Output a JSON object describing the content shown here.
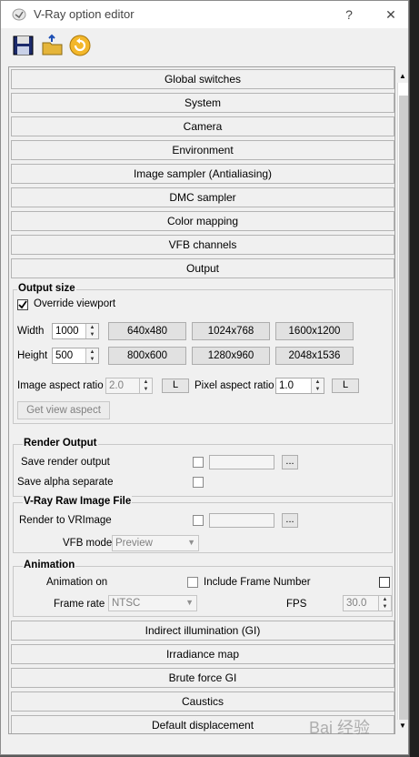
{
  "window": {
    "title": "V-Ray option editor",
    "help": "?",
    "close": "✕"
  },
  "toolbar": {
    "save_icon": "save-icon",
    "open_icon": "open-icon",
    "reset_icon": "reset-icon"
  },
  "rollouts_top": [
    "Global switches",
    "System",
    "Camera",
    "Environment",
    "Image sampler (Antialiasing)",
    "DMC sampler",
    "Color mapping",
    "VFB channels",
    "Output"
  ],
  "output_size": {
    "title": "Output size",
    "override_label": "Override viewport",
    "override_checked": true,
    "width_label": "Width",
    "width_value": "1000",
    "height_label": "Height",
    "height_value": "500",
    "presets_row1": [
      "640x480",
      "1024x768",
      "1600x1200"
    ],
    "presets_row2": [
      "800x600",
      "1280x960",
      "2048x1536"
    ],
    "image_aspect_label": "Image aspect ratio",
    "image_aspect_value": "2.0",
    "lock_label": "L",
    "pixel_aspect_label": "Pixel aspect ratio",
    "pixel_aspect_value": "1.0",
    "get_view_aspect": "Get view aspect"
  },
  "render_output": {
    "title": "Render Output",
    "save_render_label": "Save render output",
    "save_alpha_label": "Save alpha separate",
    "browse": "..."
  },
  "vray_raw": {
    "title": "V-Ray Raw Image File",
    "render_to_label": "Render to VRImage",
    "vfb_mode_label": "VFB mode",
    "vfb_mode_value": "Preview",
    "browse": "..."
  },
  "animation": {
    "title": "Animation",
    "animation_on_label": "Animation on",
    "include_frame_label": "Include Frame Number",
    "frame_rate_label": "Frame rate",
    "frame_rate_value": "NTSC",
    "fps_label": "FPS",
    "fps_value": "30.0"
  },
  "rollouts_bottom": [
    "Indirect illumination (GI)",
    "Irradiance map",
    "Brute force GI",
    "Caustics",
    "Default displacement"
  ],
  "watermark": "Bai 经验"
}
